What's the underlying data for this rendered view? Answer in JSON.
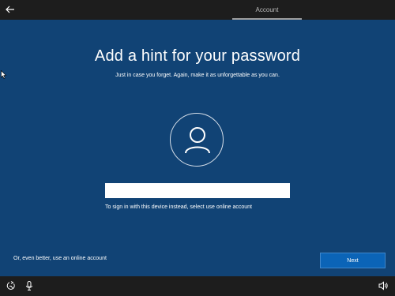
{
  "topbar": {
    "back_icon": "arrow-left-icon",
    "active_tab": "Account"
  },
  "main": {
    "title": "Add a hint for your password",
    "subtitle": "Just in case you forget. Again, make it as unforgettable as you can.",
    "avatar_icon": "user-icon",
    "hint_input": {
      "value": "",
      "placeholder": ""
    },
    "online_account_link": "To sign in with this device instead, select use online account"
  },
  "footer": {
    "online_account_link": "Or, even better, use an online account",
    "next_label": "Next"
  },
  "taskbar": {
    "icons": [
      "ease-of-access-icon",
      "microphone-icon",
      "volume-icon"
    ]
  },
  "colors": {
    "background": "#114375",
    "bars": "#1d1d1d",
    "accent_button": "#0b64b7"
  }
}
